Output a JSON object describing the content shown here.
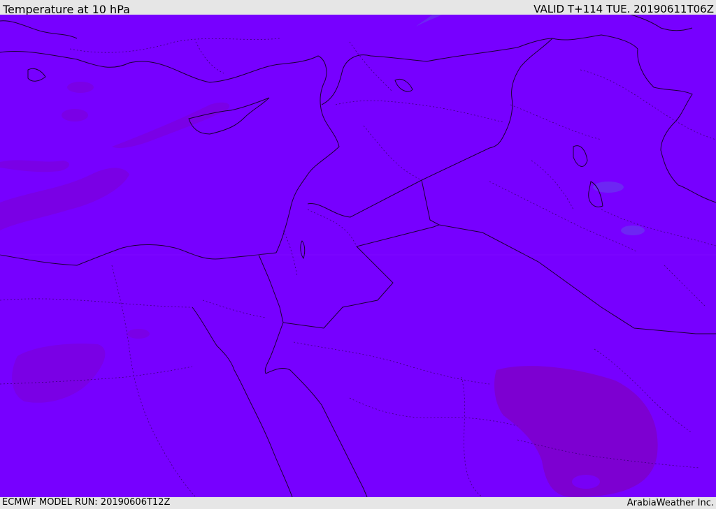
{
  "header": {
    "title": "Temperature at 10 hPa",
    "valid_time": "VALID T+114 TUE. 20190611T06Z"
  },
  "footer": {
    "model_run": "ECMWF MODEL RUN: 20190606T12Z",
    "credit": "ArabiaWeather Inc."
  },
  "map": {
    "field_colors": {
      "base": "#7700ff",
      "warmer": "#7a00e0",
      "warmest": "#7d00cc",
      "cooler": "#6a30f0"
    },
    "border_color": "#1a0033",
    "internal_border_color": "#3a0077"
  }
}
